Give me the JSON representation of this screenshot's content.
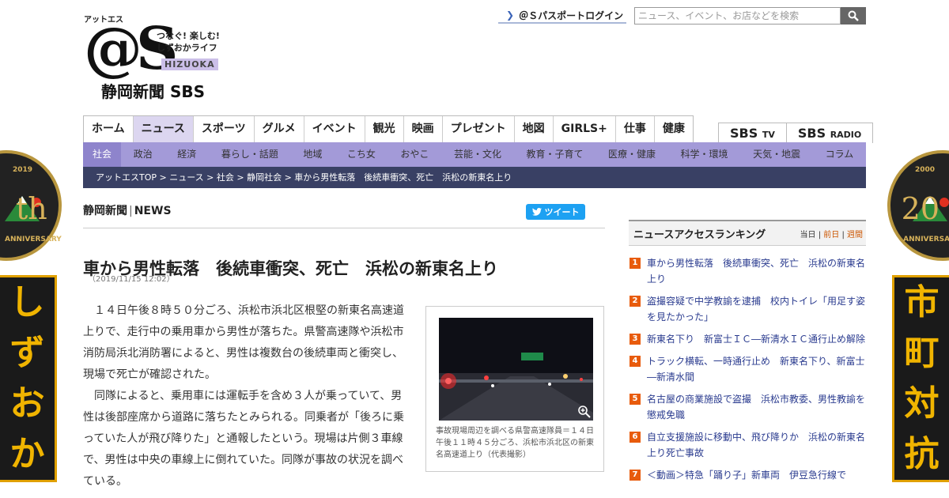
{
  "side_banners": {
    "left": {
      "year": "2019",
      "numeral": "th",
      "anniversary": "ANNIVERSARY",
      "text": [
        "し",
        "ず",
        "お",
        "か"
      ]
    },
    "right": {
      "year": "2000",
      "numeral": "20",
      "anniversary": "ANNIVERSARY",
      "text": [
        "市",
        "町",
        "対",
        "抗"
      ]
    }
  },
  "header": {
    "logo_ruby": "アットエス",
    "logo_mark": "@S",
    "logo_tagline": [
      "つなぐ! 楽しむ!",
      "しずおかライフ"
    ],
    "logo_hizuoka": "HIZUOKA",
    "logo_newspaper": "静岡新聞 SBS",
    "passport_login": "＠Ｓパスポートログイン",
    "search_placeholder": "ニュース、イベント、お店などを検索"
  },
  "global_nav": {
    "items": [
      "ホーム",
      "ニュース",
      "スポーツ",
      "グルメ",
      "イベント",
      "観光",
      "映画",
      "プレゼント",
      "地図",
      "GIRLS+",
      "仕事",
      "健康"
    ],
    "active_index": 1,
    "sbs_links": [
      {
        "main": "SBS",
        "sub": "TV"
      },
      {
        "main": "SBS",
        "sub": "RADIO"
      }
    ]
  },
  "sub_nav": {
    "items": [
      "社会",
      "政治",
      "経済",
      "暮らし・話題",
      "地域",
      "こち女",
      "おやこ",
      "芸能・文化",
      "教育・子育て",
      "医療・健康",
      "科学・環境",
      "天気・地震",
      "コラム"
    ],
    "active_index": 0
  },
  "breadcrumb": "アットエスTOP > ニュース > 社会 > 静岡社会 > 車から男性転落　後続車衝突、死亡　浜松の新東名上り",
  "article": {
    "brand_left": "静岡新聞",
    "brand_right": "NEWS",
    "tweet_label": "ツイート",
    "title": "車から男性転落　後続車衝突、死亡　浜松の新東名上り",
    "date": "（2019/11/15 12:02）",
    "paragraphs": [
      "１４日午後８時５０分ごろ、浜松市浜北区根堅の新東名高速道上りで、走行中の乗用車から男性が落ちた。県警高速隊や浜松市消防局浜北消防署によると、男性は複数台の後続車両と衝突し、現場で死亡が確認された。",
      "同隊によると、乗用車には運転手を含め３人が乗っていて、男性は後部座席から道路に落ちたとみられる。同乗者が「後ろに乗っていた人が飛び降りた」と通報したという。現場は片側３車線で、男性は中央の車線上に倒れていた。同隊が事故の状況を調べている。"
    ],
    "photo_caption": "事故現場周辺を調べる県警高速隊員＝１４日午後１１時４５分ごろ、浜松市浜北区の新東名高速道上り（代表撮影）",
    "zoom_icon": "magnifier-plus-icon"
  },
  "ranking": {
    "title": "ニュースアクセスランキング",
    "tabs": [
      "当日",
      "前日",
      "週間"
    ],
    "active_tab": 1,
    "items": [
      {
        "no": "1",
        "text": "車から男性転落　後続車衝突、死亡　浜松の新東名上り"
      },
      {
        "no": "2",
        "text": "盗撮容疑で中学教諭を逮捕　校内トイレ「用足す姿を見たかった」"
      },
      {
        "no": "3",
        "text": "新東名下り　新富士ＩＣ―新清水ＩＣ通行止め解除"
      },
      {
        "no": "4",
        "text": "トラック横転、一時通行止め　新東名下り、新富士―新清水間"
      },
      {
        "no": "5",
        "text": "名古屋の商業施設で盗撮　浜松市教委、男性教諭を懲戒免職"
      },
      {
        "no": "6",
        "text": "自立支援施設に移動中、飛び降りか　浜松の新東名上り死亡事故"
      },
      {
        "no": "7",
        "text": "＜動画＞特急「踊り子」新車両　伊豆急行線で"
      }
    ]
  },
  "colors": {
    "subnav": "#a39ad8",
    "breadcrumb": "#394064",
    "rank_badge": "#e85b0c",
    "tweet": "#1da1f2"
  }
}
